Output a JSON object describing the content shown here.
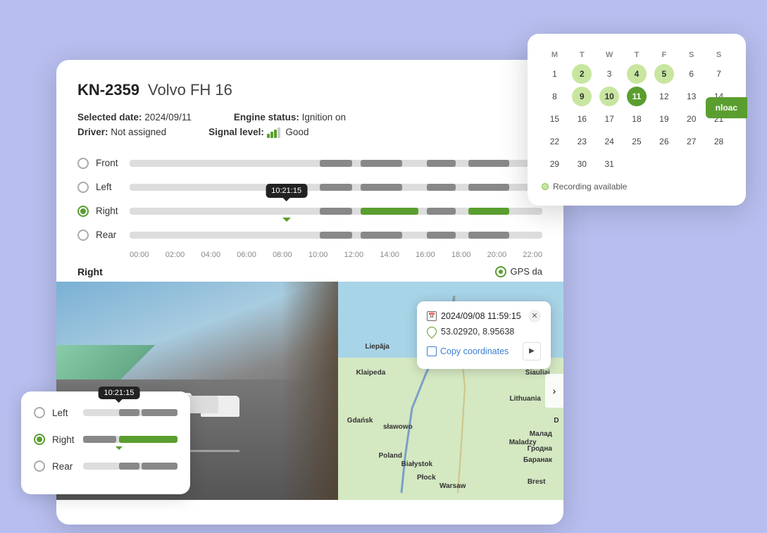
{
  "vehicle": {
    "id": "KN-2359",
    "model": "Volvo FH 16"
  },
  "details": {
    "selected_date_label": "Selected date:",
    "selected_date_value": "2024/09/11",
    "driver_label": "Driver:",
    "driver_value": "Not assigned",
    "engine_label": "Engine status:",
    "engine_value": "Ignition on",
    "signal_label": "Signal level:",
    "signal_value": "Good"
  },
  "cameras": [
    {
      "name": "Front",
      "active": false
    },
    {
      "name": "Left",
      "active": false
    },
    {
      "name": "Right",
      "active": true
    },
    {
      "name": "Rear",
      "active": false
    }
  ],
  "timeline": {
    "times": [
      "00:00",
      "02:00",
      "04:00",
      "06:00",
      "08:00",
      "10:00",
      "12:00",
      "14:00",
      "16:00",
      "18:00",
      "20:00",
      "22:00"
    ],
    "tooltip_time": "10:21:15"
  },
  "current_camera_label": "Right",
  "gps_label": "GPS da",
  "calendar": {
    "days_header": [
      "M",
      "T",
      "W",
      "T",
      "F",
      "S",
      "S"
    ],
    "days": [
      {
        "num": "1",
        "state": "normal"
      },
      {
        "num": "2",
        "state": "selected"
      },
      {
        "num": "3",
        "state": "normal"
      },
      {
        "num": "4",
        "state": "selected"
      },
      {
        "num": "5",
        "state": "selected"
      },
      {
        "num": "6",
        "state": "normal"
      },
      {
        "num": "7",
        "state": "normal"
      },
      {
        "num": "8",
        "state": "normal"
      },
      {
        "num": "9",
        "state": "selected"
      },
      {
        "num": "10",
        "state": "selected"
      },
      {
        "num": "11",
        "state": "today"
      },
      {
        "num": "12",
        "state": "normal"
      },
      {
        "num": "13",
        "state": "normal"
      },
      {
        "num": "14",
        "state": "normal"
      },
      {
        "num": "15",
        "state": "normal"
      },
      {
        "num": "16",
        "state": "normal"
      },
      {
        "num": "17",
        "state": "normal"
      },
      {
        "num": "18",
        "state": "normal"
      },
      {
        "num": "19",
        "state": "normal"
      },
      {
        "num": "20",
        "state": "normal"
      },
      {
        "num": "21",
        "state": "normal"
      },
      {
        "num": "22",
        "state": "normal"
      },
      {
        "num": "23",
        "state": "normal"
      },
      {
        "num": "24",
        "state": "normal"
      },
      {
        "num": "25",
        "state": "normal"
      },
      {
        "num": "26",
        "state": "normal"
      },
      {
        "num": "27",
        "state": "normal"
      },
      {
        "num": "28",
        "state": "normal"
      },
      {
        "num": "29",
        "state": "normal"
      },
      {
        "num": "30",
        "state": "normal"
      },
      {
        "num": "31",
        "state": "normal"
      }
    ],
    "legend": "Recording available",
    "download_label": "nloac"
  },
  "gps_popup": {
    "date": "2024/09/08 11:59:15",
    "coordinates": "53.02920, 8.95638",
    "copy_label": "Copy coordinates"
  },
  "mini_popup": {
    "cameras": [
      {
        "name": "Left",
        "active": false
      },
      {
        "name": "Right",
        "active": true
      },
      {
        "name": "Rear",
        "active": false
      }
    ],
    "tooltip_time": "10:21:15"
  }
}
